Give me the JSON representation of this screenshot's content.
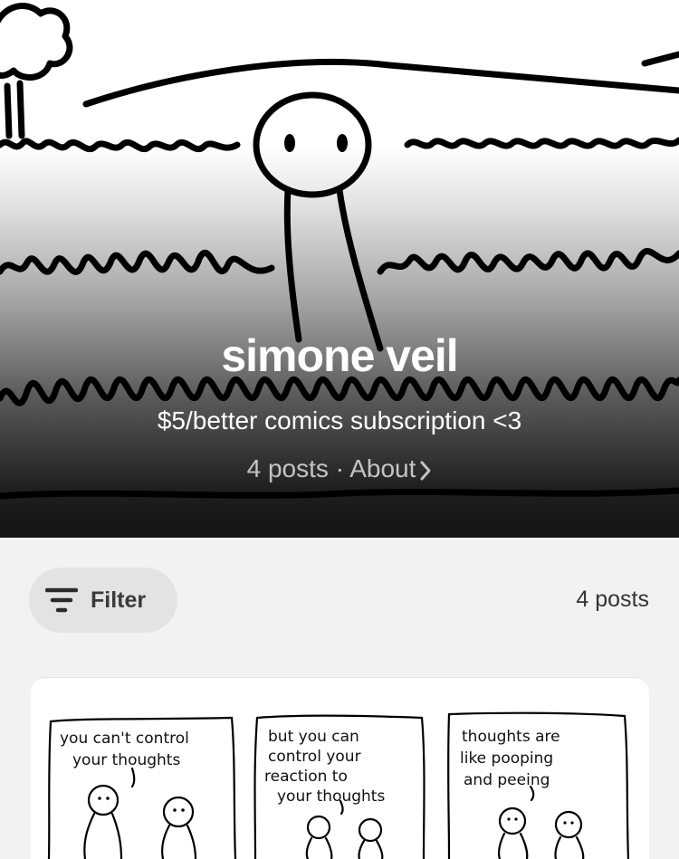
{
  "header": {
    "creator_name": "simone veil",
    "tagline": "$5/better comics subscription <3",
    "post_count_label": "4 posts",
    "separator": "·",
    "about_label": "About"
  },
  "toolbar": {
    "filter_label": "Filter",
    "post_count": "4 posts"
  },
  "post": {
    "panels": [
      {
        "lines": [
          "you can't control",
          "your thoughts"
        ]
      },
      {
        "lines": [
          "but you can",
          "control your",
          "reaction to",
          "your thoughts"
        ]
      },
      {
        "lines": [
          "thoughts are",
          "like pooping",
          "and peeing"
        ]
      }
    ]
  },
  "colors": {
    "page_background": "#f2f2f2",
    "filter_pill": "#e3e3e3",
    "ink": "#000000"
  },
  "icons": [
    "filter-icon",
    "chevron-right-icon"
  ]
}
